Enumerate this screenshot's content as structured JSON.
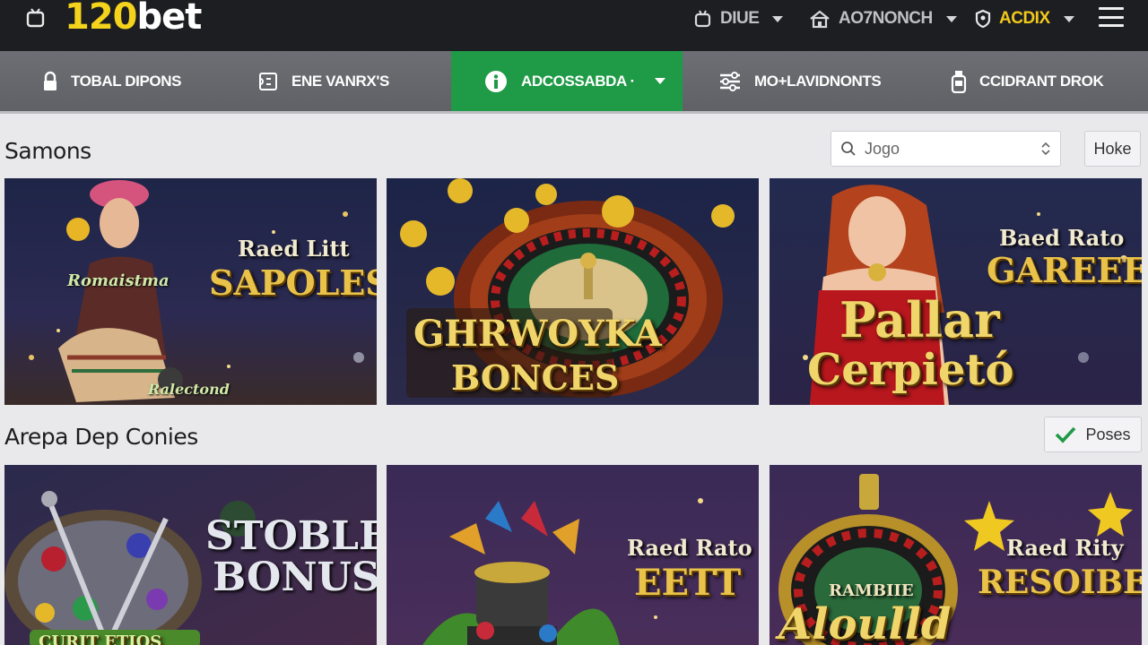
{
  "header": {
    "logo_number": "120",
    "logo_text": "bet",
    "items": [
      {
        "label": "DIUE",
        "icon": "tv-icon"
      },
      {
        "label": "AO7NONCH",
        "icon": "home-icon"
      },
      {
        "label": "ACDIX",
        "icon": "shield-user-icon"
      }
    ]
  },
  "nav": {
    "items": [
      {
        "label": "TOBAL DIPONS",
        "icon": "lock-icon"
      },
      {
        "label": "ENE VANRX'S",
        "icon": "ticket-icon"
      },
      {
        "label": "ADCOSSABDA ·",
        "icon": "info-icon"
      },
      {
        "label": "MO+LAVIDNONTS",
        "icon": "sliders-icon"
      },
      {
        "label": "CCIDRANT DROK",
        "icon": "bottle-icon"
      }
    ],
    "active_index": 2
  },
  "section1": {
    "title": "Samons",
    "search_placeholder": "Jogo",
    "button_label": "Hoke"
  },
  "section2": {
    "title": "Arepa Dep Conies",
    "button_label": "Poses"
  },
  "cards": [
    {
      "line1": "Raed Litt",
      "line2": "SAPOLES",
      "tag": "Romaistma",
      "tag2": "Ralectond"
    },
    {
      "line1": "",
      "line2": "BONCES",
      "big": "GHRWOYKA"
    },
    {
      "line1": "Baed Rato",
      "line2": "GAREEE",
      "big1": "Pallar",
      "big2": "Cerpietó"
    },
    {
      "line1": "STOBLE",
      "line2": "BONUS",
      "tag": "CURIT ETIOS"
    },
    {
      "line1": "Raed Rato",
      "line2": "EETT"
    },
    {
      "line1": "Raed Rity",
      "line2": "RESOIBES",
      "tag": "RAMBIIE",
      "big": "Aloulld"
    }
  ]
}
